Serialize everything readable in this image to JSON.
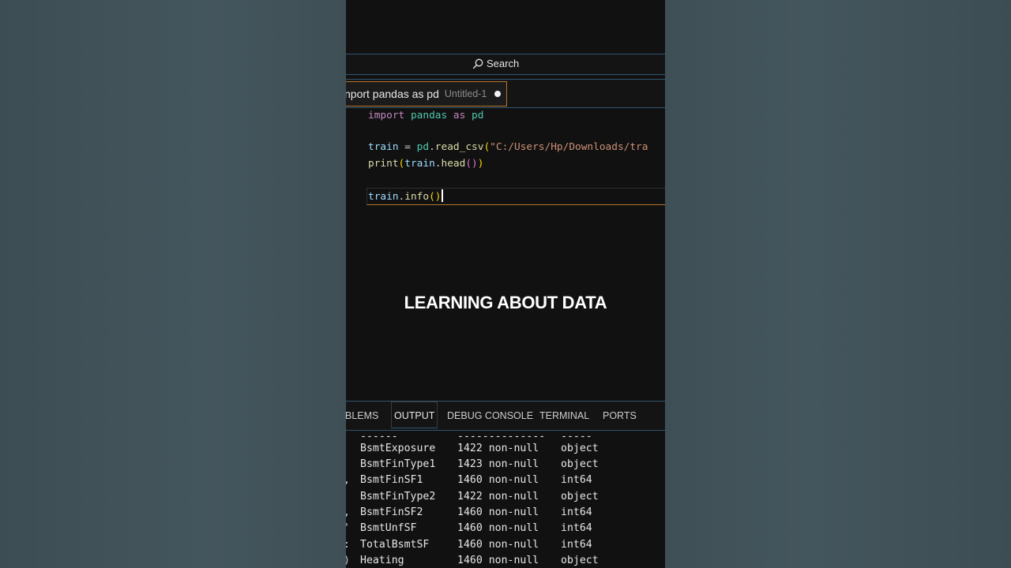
{
  "search": {
    "label": "Search"
  },
  "tab": {
    "title": "nport pandas as pd",
    "subtitle": "Untitled-1"
  },
  "code": {
    "line1": {
      "kw": "import",
      "mod": "pandas",
      "as": "as",
      "alias": "pd"
    },
    "line3": {
      "var": "train",
      "eq": " = ",
      "obj": "pd",
      "dot": ".",
      "fn": "read_csv",
      "open": "(",
      "str": "\"C:/Users/Hp/Downloads/tra"
    },
    "line4": {
      "fn": "print",
      "open": "(",
      "var": "train",
      "dot": ".",
      "method": "head",
      "inner": "()",
      "close": ")"
    },
    "line6": {
      "var": "train",
      "dot": ".",
      "method": "info",
      "parens": "()"
    }
  },
  "overlay": {
    "text": "LEARNING ABOUT DATA"
  },
  "panel": {
    "tabs": [
      "BLEMS",
      "OUTPUT",
      "DEBUG CONSOLE",
      "TERMINAL",
      "PORTS"
    ],
    "active": "OUTPUT"
  },
  "output": {
    "rows": [
      {
        "idx": "",
        "col": "------",
        "count": "--------------",
        "dtype": "-----"
      },
      {
        "idx": "",
        "col": "BsmtExposure",
        "count": "1422 non-null",
        "dtype": "object"
      },
      {
        "idx": "",
        "col": "BsmtFinType1",
        "count": "1423 non-null",
        "dtype": "object"
      },
      {
        "idx": ",",
        "col": "BsmtFinSF1",
        "count": "1460 non-null",
        "dtype": "int64"
      },
      {
        "idx": "",
        "col": "BsmtFinType2",
        "count": "1422 non-null",
        "dtype": "object"
      },
      {
        "idx": ",",
        "col": "BsmtFinSF2",
        "count": "1460 non-null",
        "dtype": "int64"
      },
      {
        "idx": "'",
        "col": "BsmtUnfSF",
        "count": "1460 non-null",
        "dtype": "int64"
      },
      {
        "idx": ":",
        "col": "TotalBsmtSF",
        "count": "1460 non-null",
        "dtype": "int64"
      },
      {
        "idx": ")",
        "col": "Heating",
        "count": "1460 non-null",
        "dtype": "object"
      }
    ]
  }
}
